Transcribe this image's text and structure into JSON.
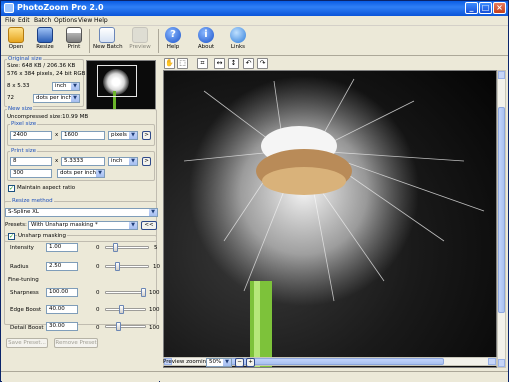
{
  "window": {
    "title": "PhotoZoom Pro 2.0"
  },
  "menu": [
    "File",
    "Edit",
    "Batch",
    "Options",
    "View",
    "Help"
  ],
  "toolbar": {
    "open": "Open",
    "resize": "Resize",
    "print": "Print",
    "new_batch": "New Batch",
    "preview": "Preview",
    "help": "Help",
    "about": "About",
    "links": "Links"
  },
  "original": {
    "section": "Original size",
    "size_line": "Size: 648 KB / 206.36 KB",
    "pixels_line": "576 x 384 pixels, 24 bit RGB",
    "dims": "8 x 5.33",
    "dims_unit": "inch",
    "resolution": "72",
    "resolution_unit": "dots per inch"
  },
  "newsize": {
    "section": "New size",
    "uncompressed": "Uncompressed size:10.99 MB",
    "pixel_section": "Pixel size",
    "px_width": "2400",
    "px_height": "1600",
    "px_unit": "pixels",
    "print_section": "Print size",
    "print_width": "8",
    "print_height": "5.3333",
    "print_unit": "inch",
    "print_res": "300",
    "print_res_unit": "dots per inch",
    "maintain_aspect": "Maintain aspect ratio",
    "times": "x",
    "arrow": ">"
  },
  "resize": {
    "section": "Resize method",
    "method": "S-Spline XL",
    "presets_label": "Presets:",
    "preset": "With Unsharp masking *",
    "presets_btn": "<<",
    "unsharp": "Unsharp masking",
    "intensity_label": "Intensity",
    "intensity": "1.00",
    "intensity_min": "0",
    "intensity_max": "5",
    "intensity_level": 0.2,
    "radius_label": "Radius",
    "radius": "2.50",
    "radius_min": "0",
    "radius_max": "10",
    "radius_level": 0.25,
    "finetune": "Fine-tuning",
    "sharpness_label": "Sharpness",
    "sharpness": "100.00",
    "sharpness_min": "0",
    "sharpness_max": "100",
    "sharpness_level": 1.0,
    "edge_label": "Edge Boost",
    "edge": "40.00",
    "edge_min": "0",
    "edge_max": "100",
    "edge_level": 0.4,
    "detail_label": "Detail Boost",
    "detail": "30.00",
    "detail_min": "0",
    "detail_max": "100",
    "detail_level": 0.3,
    "save_preset": "Save Preset...",
    "remove_preset": "Remove Preset"
  },
  "preview": {
    "zoom_label": "Preview zooming:",
    "zoom": "50%",
    "minus": "−",
    "plus": "+"
  }
}
